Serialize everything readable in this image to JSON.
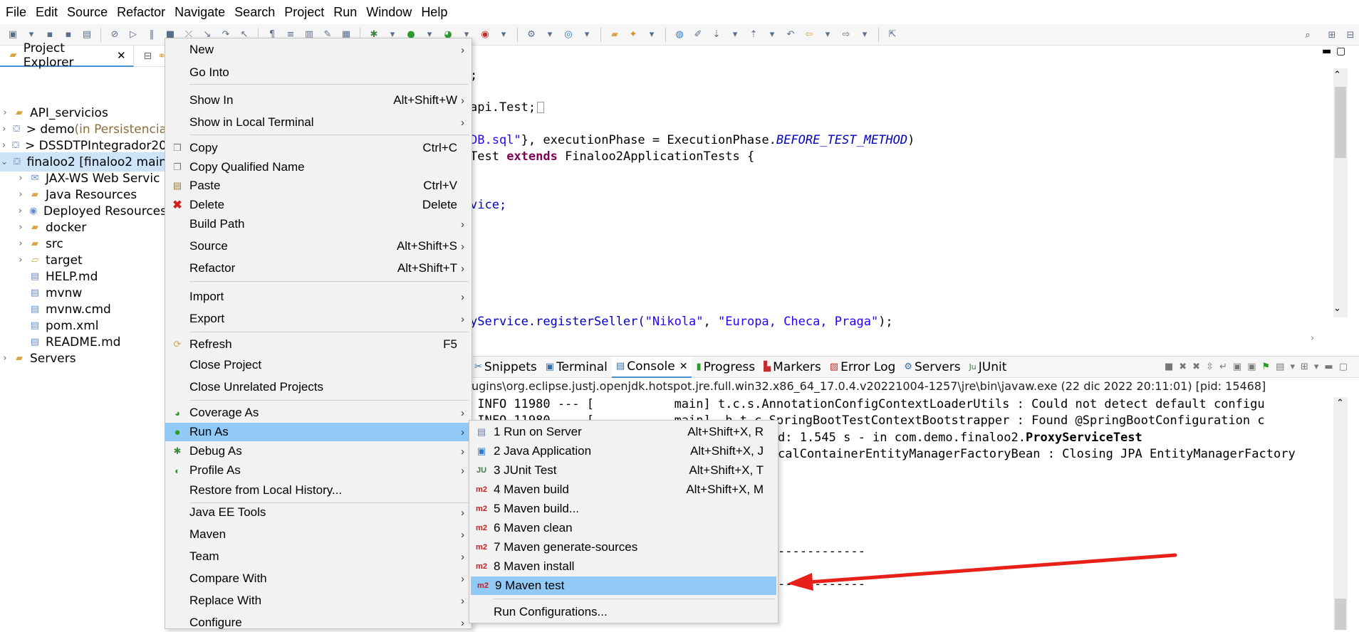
{
  "menubar": [
    "File",
    "Edit",
    "Source",
    "Refactor",
    "Navigate",
    "Search",
    "Project",
    "Run",
    "Window",
    "Help"
  ],
  "explorer": {
    "tab_label": "Project Explorer",
    "items": [
      {
        "label": "API_servicios",
        "extra": ""
      },
      {
        "label": "> demo",
        "extra": " (in Persistencia"
      },
      {
        "label": "> DSSDTPIntegrador20",
        "extra": ""
      },
      {
        "label": "finaloo2 [finaloo2 main",
        "extra": ""
      },
      {
        "label": "JAX-WS Web Servic",
        "extra": ""
      },
      {
        "label": "Java Resources",
        "extra": ""
      },
      {
        "label": "Deployed Resources",
        "extra": ""
      },
      {
        "label": "docker",
        "extra": ""
      },
      {
        "label": "src",
        "extra": ""
      },
      {
        "label": "target",
        "extra": ""
      },
      {
        "label": "HELP.md",
        "extra": ""
      },
      {
        "label": "mvnw",
        "extra": ""
      },
      {
        "label": "mvnw.cmd",
        "extra": ""
      },
      {
        "label": "pom.xml",
        "extra": ""
      },
      {
        "label": "README.md",
        "extra": ""
      },
      {
        "label": "Servers",
        "extra": ""
      }
    ]
  },
  "editor": {
    "l1": ";",
    "l2": "api.Test;",
    "l3a": "DB.sql\"",
    "l3b": "}, executionPhase = ExecutionPhase.",
    "l3c": "BEFORE_TEST_METHOD",
    "l3d": ")",
    "l4a": "Test ",
    "l4b": "extends",
    "l4c": " Finaloo2ApplicationTests {",
    "l5": "vice;",
    "l6a": "yService.registerSeller(",
    "l6b": "\"Nikola\"",
    "l6c": ", ",
    "l6d": "\"Europa, Checa, Praga\"",
    "l6e": ");"
  },
  "views": {
    "tabs": [
      "Snippets",
      "Terminal",
      "Console",
      "Progress",
      "Markers",
      "Error Log",
      "Servers",
      "JUnit"
    ],
    "console_path": "ugins\\org.eclipse.justj.openjdk.hotspot.jre.full.win32.x86_64_17.0.4.v20221004-1257\\jre\\bin\\javaw.exe  (22 dic 2022 20:11:01) [pid: 15468]",
    "lines": [
      " INFO 11980 --- [           main] t.c.s.AnnotationConfigContextLoaderUtils : Could not detect default configu",
      " INFO 11980 --- [           main] .b.t.c.SpringBootTestContextBootstrapper : Found @SpringBootConfiguration c",
      "d: 1.545 s - in com.demo.finaloo2.",
      "calContainerEntityManagerFactoryBean : Closing JPA EntityManagerFactory",
      "------------",
      "------------"
    ],
    "bold_class": "ProxyServiceTest"
  },
  "context_menu": {
    "items": [
      {
        "label": "New",
        "shortcut": "",
        "arrow": true
      },
      {
        "label": "Go Into",
        "shortcut": "",
        "arrow": false
      },
      {
        "label": "Show In",
        "shortcut": "Alt+Shift+W",
        "arrow": true
      },
      {
        "label": "Show in Local Terminal",
        "shortcut": "",
        "arrow": true
      },
      {
        "label": "Copy",
        "shortcut": "Ctrl+C",
        "arrow": false
      },
      {
        "label": "Copy Qualified Name",
        "shortcut": "",
        "arrow": false
      },
      {
        "label": "Paste",
        "shortcut": "Ctrl+V",
        "arrow": false
      },
      {
        "label": "Delete",
        "shortcut": "Delete",
        "arrow": false
      },
      {
        "label": "Build Path",
        "shortcut": "",
        "arrow": true
      },
      {
        "label": "Source",
        "shortcut": "Alt+Shift+S",
        "arrow": true
      },
      {
        "label": "Refactor",
        "shortcut": "Alt+Shift+T",
        "arrow": true
      },
      {
        "label": "Import",
        "shortcut": "",
        "arrow": true
      },
      {
        "label": "Export",
        "shortcut": "",
        "arrow": true
      },
      {
        "label": "Refresh",
        "shortcut": "F5",
        "arrow": false
      },
      {
        "label": "Close Project",
        "shortcut": "",
        "arrow": false
      },
      {
        "label": "Close Unrelated Projects",
        "shortcut": "",
        "arrow": false
      },
      {
        "label": "Coverage As",
        "shortcut": "",
        "arrow": true
      },
      {
        "label": "Run As",
        "shortcut": "",
        "arrow": true
      },
      {
        "label": "Debug As",
        "shortcut": "",
        "arrow": true
      },
      {
        "label": "Profile As",
        "shortcut": "",
        "arrow": true
      },
      {
        "label": "Restore from Local History...",
        "shortcut": "",
        "arrow": false
      },
      {
        "label": "Java EE Tools",
        "shortcut": "",
        "arrow": true
      },
      {
        "label": "Maven",
        "shortcut": "",
        "arrow": true
      },
      {
        "label": "Team",
        "shortcut": "",
        "arrow": true
      },
      {
        "label": "Compare With",
        "shortcut": "",
        "arrow": true
      },
      {
        "label": "Replace With",
        "shortcut": "",
        "arrow": true
      },
      {
        "label": "Configure",
        "shortcut": "",
        "arrow": true
      }
    ]
  },
  "run_as_menu": {
    "items": [
      {
        "label": "1 Run on Server",
        "shortcut": "Alt+Shift+X, R",
        "icon": "server"
      },
      {
        "label": "2 Java Application",
        "shortcut": "Alt+Shift+X, J",
        "icon": "java"
      },
      {
        "label": "3 JUnit Test",
        "shortcut": "Alt+Shift+X, T",
        "icon": "junit"
      },
      {
        "label": "4 Maven build",
        "shortcut": "Alt+Shift+X, M",
        "icon": "m2"
      },
      {
        "label": "5 Maven build...",
        "shortcut": "",
        "icon": "m2"
      },
      {
        "label": "6 Maven clean",
        "shortcut": "",
        "icon": "m2"
      },
      {
        "label": "7 Maven generate-sources",
        "shortcut": "",
        "icon": "m2"
      },
      {
        "label": "8 Maven install",
        "shortcut": "",
        "icon": "m2"
      },
      {
        "label": "9 Maven test",
        "shortcut": "",
        "icon": "m2"
      },
      {
        "label": "Run Configurations...",
        "shortcut": "",
        "icon": ""
      }
    ],
    "m2_icon_text": "m2",
    "junit_icon_text": "JU",
    "highlighted_index": 8
  },
  "colors": {
    "highlight": "#91c9f7",
    "arrow": "#e8201a",
    "selection": "#cde3f8"
  }
}
